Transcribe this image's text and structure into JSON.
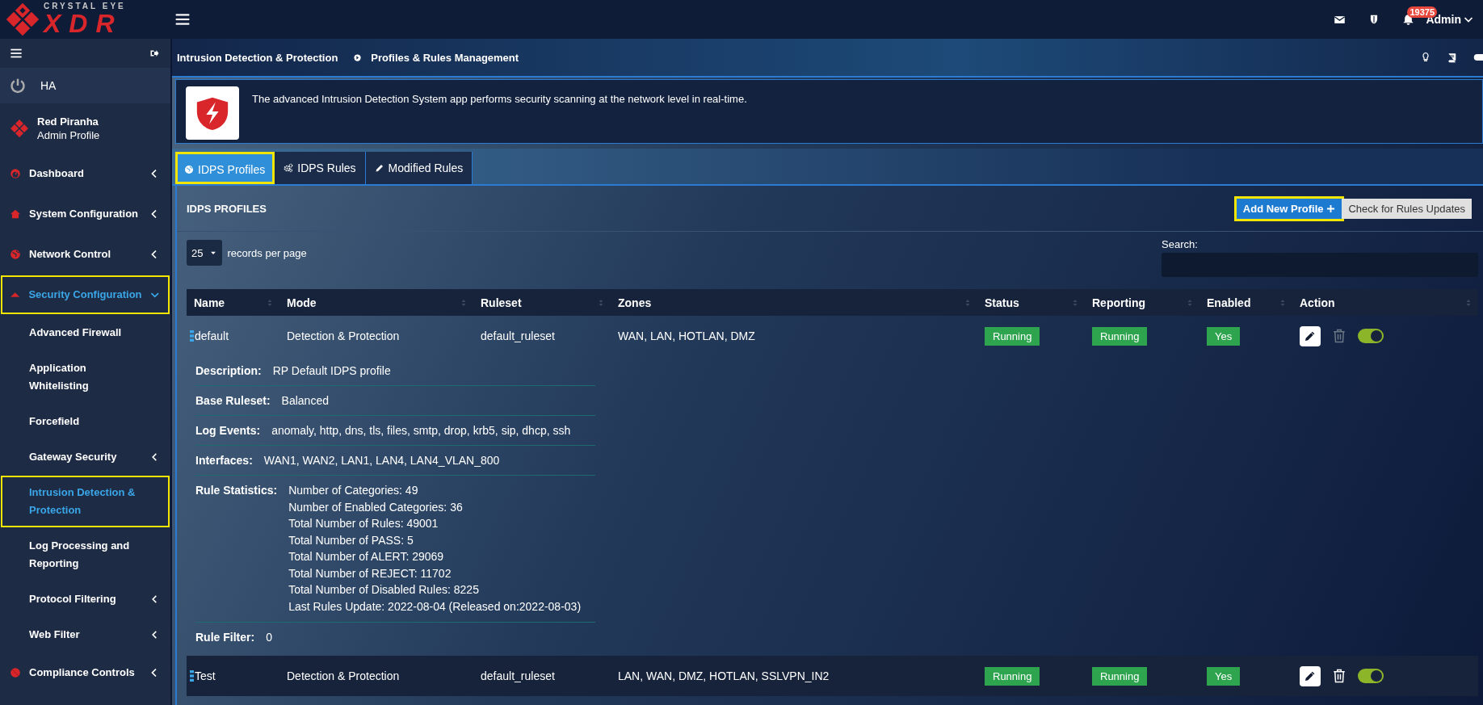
{
  "logo": {
    "tagline": "CRYSTAL EYE",
    "name": "XDR"
  },
  "topbar": {
    "notification_count": "19375",
    "user": "Admin"
  },
  "sidebar": {
    "ha_label": "HA",
    "profile": {
      "name": "Red Piranha",
      "role": "Admin Profile"
    },
    "items": [
      {
        "label": "Dashboard",
        "expandable": true,
        "expanded": false,
        "selected": false,
        "highlighted": false
      },
      {
        "label": "System Configuration",
        "expandable": true,
        "expanded": false,
        "selected": false,
        "highlighted": false
      },
      {
        "label": "Network Control",
        "expandable": true,
        "expanded": false,
        "selected": false,
        "highlighted": false
      },
      {
        "label": "Security Configuration",
        "expandable": true,
        "expanded": true,
        "selected": true,
        "highlighted": true,
        "children": [
          {
            "label": "Advanced Firewall",
            "expandable": false,
            "selected": false,
            "highlighted": false
          },
          {
            "label": "Application Whitelisting",
            "expandable": false,
            "selected": false,
            "highlighted": false
          },
          {
            "label": "Forcefield",
            "expandable": false,
            "selected": false,
            "highlighted": false
          },
          {
            "label": "Gateway Security",
            "expandable": true,
            "selected": false,
            "highlighted": false
          },
          {
            "label": "Intrusion Detection & Protection",
            "expandable": false,
            "selected": true,
            "highlighted": true
          },
          {
            "label": "Log Processing and Reporting",
            "expandable": false,
            "selected": false,
            "highlighted": false
          },
          {
            "label": "Protocol Filtering",
            "expandable": true,
            "selected": false,
            "highlighted": false
          },
          {
            "label": "Web Filter",
            "expandable": true,
            "selected": false,
            "highlighted": false
          }
        ]
      },
      {
        "label": "Compliance Controls",
        "expandable": true,
        "expanded": false,
        "selected": false,
        "highlighted": false
      }
    ]
  },
  "breadcrumb": [
    "Intrusion Detection & Protection",
    "Profiles & Rules Management"
  ],
  "info": {
    "text": "The advanced Intrusion Detection System app performs security scanning at the network level in real-time."
  },
  "tabs": [
    {
      "label": "IDPS Profiles",
      "selected": true,
      "highlighted": true
    },
    {
      "label": "IDPS Rules",
      "selected": false,
      "highlighted": false
    },
    {
      "label": "Modified Rules",
      "selected": false,
      "highlighted": false
    }
  ],
  "panel": {
    "title": "IDPS PROFILES",
    "buttons": [
      {
        "label": "Add New Profile",
        "kind": "primary",
        "highlighted": true
      },
      {
        "label": "Check for Rules Updates",
        "kind": "secondary",
        "highlighted": false
      }
    ],
    "page_size": "25",
    "page_size_label": "records per page",
    "search_label": "Search:",
    "table": {
      "columns": [
        "Name",
        "Mode",
        "Ruleset",
        "Zones",
        "Status",
        "Reporting",
        "Enabled",
        "Action"
      ],
      "rows": [
        {
          "name": "default",
          "mode": "Detection & Protection",
          "ruleset": "default_ruleset",
          "zones": "WAN, LAN, HOTLAN, DMZ",
          "status": "Running",
          "reporting": "Running",
          "enabled": "Yes",
          "delete_disabled": true,
          "on": true,
          "expanded": true,
          "details": [
            {
              "label": "Description:",
              "value": "RP Default IDPS profile"
            },
            {
              "label": "Base Ruleset:",
              "value": "Balanced"
            },
            {
              "label": "Log Events:",
              "value": "anomaly, http, dns, tls, files, smtp, drop, krb5, sip, dhcp, ssh"
            },
            {
              "label": "Interfaces:",
              "value": "WAN1, WAN2, LAN1, LAN4, LAN4_VLAN_800"
            },
            {
              "label": "Rule Statistics:",
              "lines": [
                "Number of Categories: 49",
                "Number of Enabled Categories: 36",
                "Total Number of Rules: 49001",
                "Total Number of PASS: 5",
                "Total Number of ALERT: 29069",
                "Total Number of REJECT: 11702",
                "Total Number of Disabled Rules: 8225",
                "Last Rules Update: 2022-08-04 (Released on:2022-08-03)"
              ]
            },
            {
              "label": "Rule Filter:",
              "value": "0"
            }
          ]
        },
        {
          "name": "Test",
          "mode": "Detection & Protection",
          "ruleset": "default_ruleset",
          "zones": "LAN, WAN, DMZ, HOTLAN, SSLVPN_IN2",
          "status": "Running",
          "reporting": "Running",
          "enabled": "Yes",
          "delete_disabled": false,
          "on": true,
          "expanded": false
        }
      ]
    }
  }
}
